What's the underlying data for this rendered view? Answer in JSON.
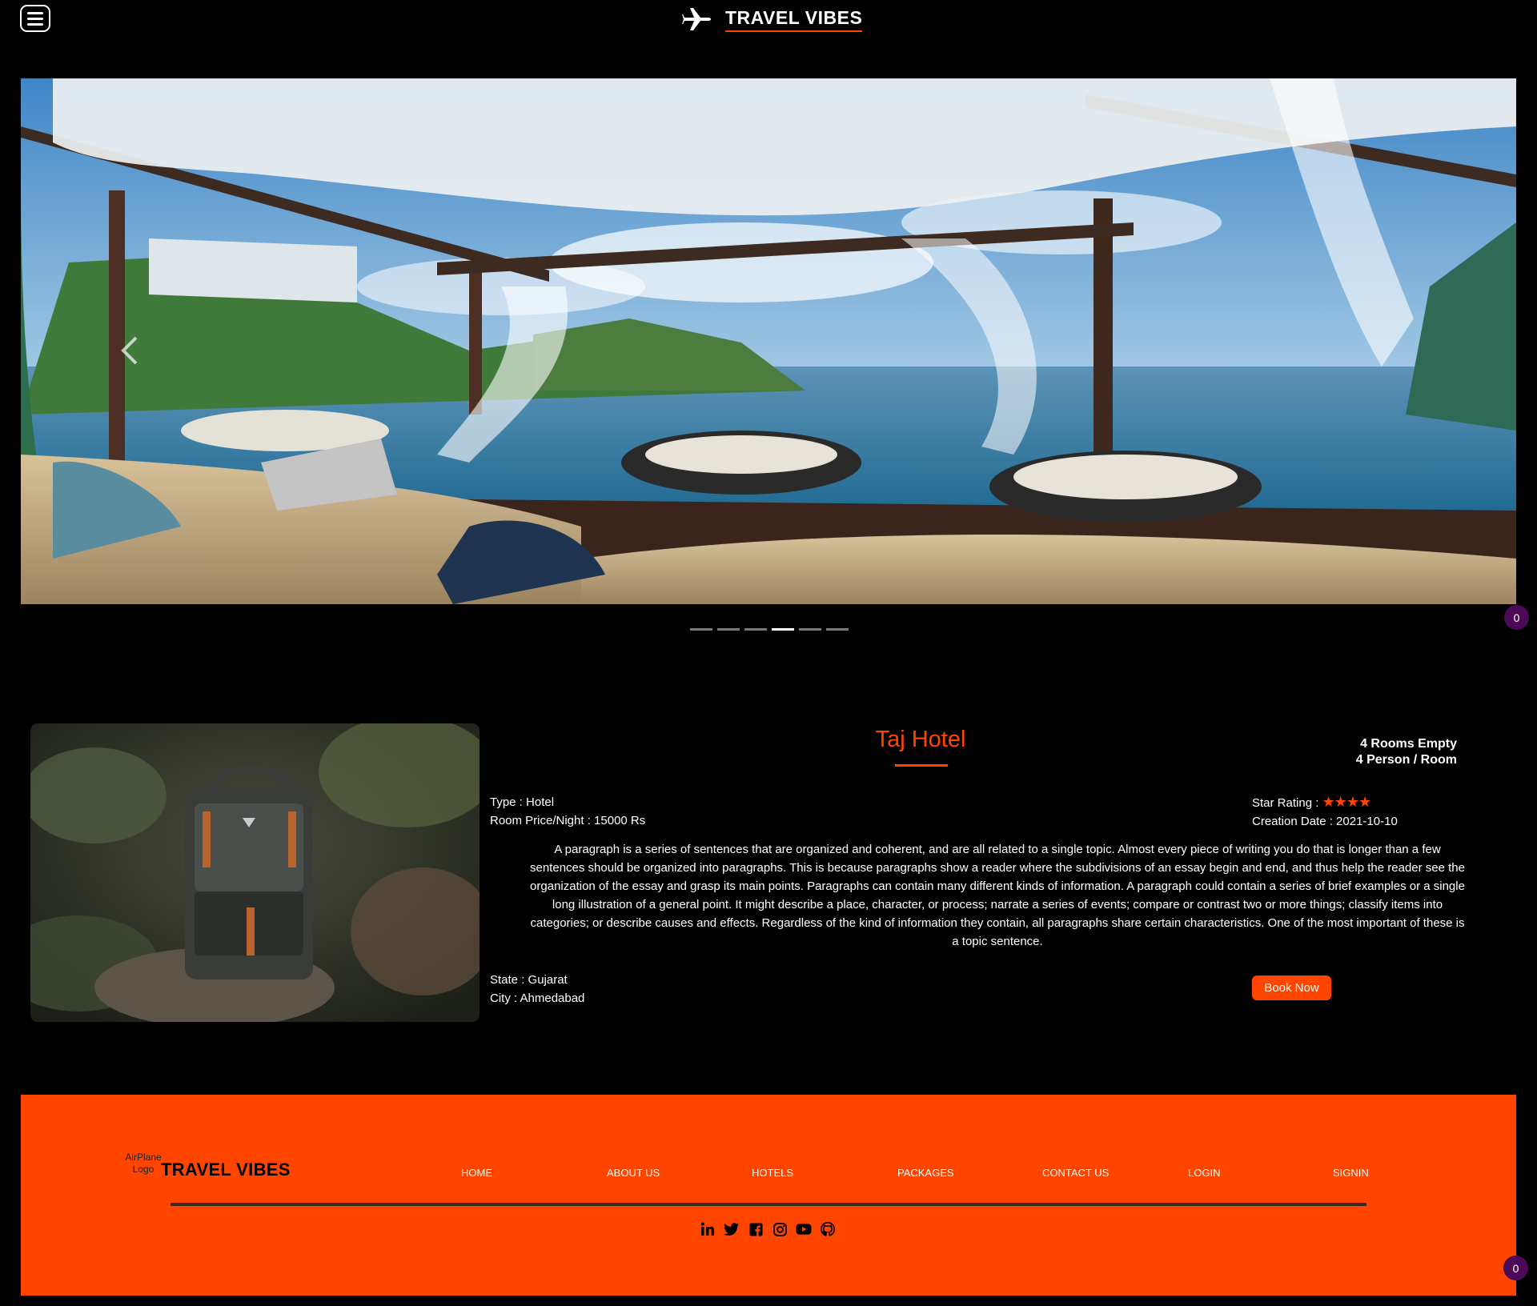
{
  "header": {
    "title": "TRAVEL VIBES",
    "menu_icon": "hamburger-menu-icon",
    "logo_icon": "airplane-icon"
  },
  "carousel": {
    "slide_count": 6,
    "active_index": 3,
    "counter": "0"
  },
  "hotel": {
    "name": "Taj Hotel",
    "rooms_empty": "4 Rooms Empty",
    "person_per_room": "4 Person / Room",
    "type": "Type : Hotel",
    "price": "Room Price/Night : 15000 Rs",
    "star_label": "Star Rating :",
    "stars": "★★★★",
    "star_rating": 4,
    "creation_date": "Creation Date : 2021-10-10",
    "description": "A paragraph is a series of sentences that are organized and coherent, and are all related to a single topic. Almost every piece of writing you do that is longer than a few sentences should be organized into paragraphs. This is because paragraphs show a reader where the subdivisions of an essay begin and end, and thus help the reader see the organization of the essay and grasp its main points. Paragraphs can contain many different kinds of information. A paragraph could contain a series of brief examples or a single long illustration of a general point. It might describe a place, character, or process; narrate a series of events; compare or contrast two or more things; classify items into categories; or describe causes and effects. Regardless of the kind of information they contain, all paragraphs share certain characteristics. One of the most important of these is a topic sentence.",
    "state": "State : Gujarat",
    "city": "City : Ahmedabad",
    "book_label": "Book Now"
  },
  "footer": {
    "logo_alt": "AirPlane Logo",
    "title": "TRAVEL VIBES",
    "nav": [
      "HOME",
      "ABOUT US",
      "HOTELS",
      "PACKAGES",
      "CONTACT US",
      "LOGIN",
      "SIGNIN"
    ],
    "social": [
      "linkedin-icon",
      "twitter-icon",
      "facebook-icon",
      "instagram-icon",
      "youtube-icon",
      "github-icon"
    ],
    "counter": "0"
  },
  "colors": {
    "accent": "#ff4500",
    "background": "#000000",
    "badge": "#4b0a57"
  }
}
